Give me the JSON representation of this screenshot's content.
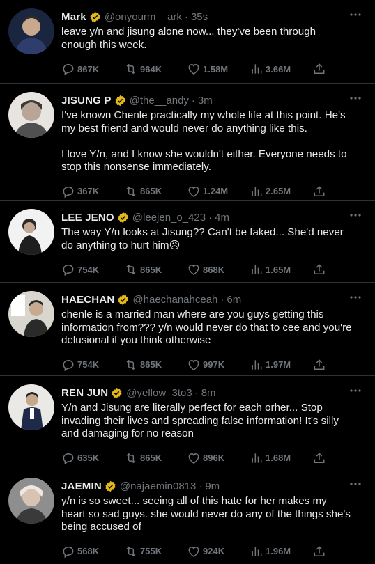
{
  "colors": {
    "background": "#000000",
    "text": "#e7e9ea",
    "muted": "#71767b",
    "verified_gold": "#e2b719",
    "divider": "#2f3336"
  },
  "icons": {
    "reply": "reply-icon",
    "retweet": "retweet-icon",
    "like": "heart-icon",
    "views": "views-icon",
    "share": "share-icon",
    "more": "more-icon",
    "verified": "verified-badge-icon"
  },
  "tweets": [
    {
      "name": "Mark",
      "handle": "@onyourm__ark",
      "time": "35s",
      "sep": "·",
      "text": "leave y/n and jisung alone now... they've been through enough this week.",
      "replies": "867K",
      "retweets": "964K",
      "likes": "1.58M",
      "views": "3.66M"
    },
    {
      "name": "JISUNG P",
      "handle": "@the__andy",
      "time": "3m",
      "sep": "·",
      "text": "I've known Chenle practically my whole life at this point. He's my best friend and would never do anything like this.\n\nI love Y/n, and I know she wouldn't either. Everyone needs to stop this nonsense immediately.",
      "replies": "367K",
      "retweets": "865K",
      "likes": "1.24M",
      "views": "2.65M"
    },
    {
      "name": "LEE JENO",
      "handle": "@leejen_o_423",
      "time": "4m",
      "sep": "·",
      "text": "The way Y/n looks at Jisung?? Can't be faked... She'd never do anything to hurt him😠",
      "replies": "754K",
      "retweets": "865K",
      "likes": "868K",
      "views": "1.65M"
    },
    {
      "name": "HAECHAN",
      "handle": "@haechanahceah",
      "time": "6m",
      "sep": "·",
      "text": "chenle is a married man where are you guys getting this information from??? y/n would never do that to cee and you're delusional if you think otherwise",
      "replies": "754K",
      "retweets": "865K",
      "likes": "997K",
      "views": "1.97M"
    },
    {
      "name": "REN JUN",
      "handle": "@yellow_3to3",
      "time": "8m",
      "sep": "·",
      "text": "Y/n and Jisung are literally perfect for each orher... Stop invading their lives and spreading false information! It's silly and damaging for no reason",
      "replies": "635K",
      "retweets": "865K",
      "likes": "896K",
      "views": "1.68M"
    },
    {
      "name": "JAEMIN",
      "handle": "@najaemin0813",
      "time": "9m",
      "sep": "·",
      "text": "y/n is so sweet... seeing all of this hate for her makes my heart so sad guys. she would never do any of the things she's being accused of",
      "replies": "568K",
      "retweets": "755K",
      "likes": "924K",
      "views": "1.96M"
    }
  ]
}
